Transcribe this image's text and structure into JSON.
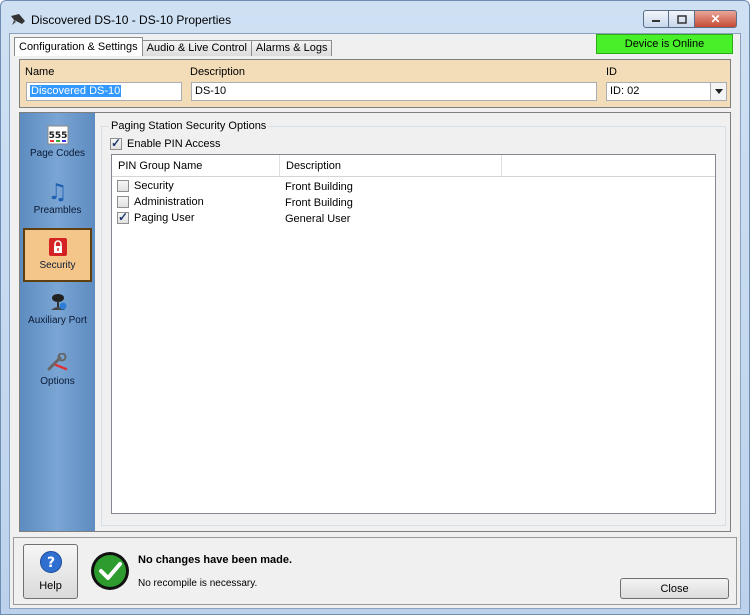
{
  "window": {
    "title": "Discovered DS-10 - DS-10 Properties",
    "controls": {
      "minimize": "—",
      "maximize": "□",
      "close": "✕"
    }
  },
  "tabs": [
    {
      "label": "Configuration & Settings",
      "active": true
    },
    {
      "label": "Audio & Live Control",
      "active": false
    },
    {
      "label": "Alarms & Logs",
      "active": false
    }
  ],
  "device_status": {
    "text": "Device is Online",
    "color": "#48f02a"
  },
  "header": {
    "name_label": "Name",
    "name_value": "Discovered DS-10",
    "description_label": "Description",
    "description_value": "DS-10",
    "id_label": "ID",
    "id_value": "ID: 02"
  },
  "sidebar": {
    "items": [
      {
        "label": "Page Codes",
        "icon": "page-codes-icon",
        "glyph": "555",
        "active": false
      },
      {
        "label": "Preambles",
        "icon": "music-note-icon",
        "glyph": "♫",
        "active": false
      },
      {
        "label": "Security",
        "icon": "lock-icon",
        "active": true
      },
      {
        "label": "Auxiliary Port",
        "icon": "microphone-icon",
        "active": false
      },
      {
        "label": "Options",
        "icon": "wrench-icon",
        "active": false
      }
    ]
  },
  "security": {
    "group_title": "Paging Station Security Options",
    "enable_pin_label": "Enable PIN Access",
    "enable_pin_checked": true,
    "columns": [
      "PIN Group Name",
      "Description"
    ],
    "rows": [
      {
        "name": "Security",
        "description": "Front Building",
        "checked": false
      },
      {
        "name": "Administration",
        "description": "Front Building",
        "checked": false
      },
      {
        "name": "Paging User",
        "description": "General User",
        "checked": true
      }
    ]
  },
  "footer": {
    "help_label": "Help",
    "message_title": "No changes have been made.",
    "message_sub": "No recompile is necessary.",
    "close_label": "Close"
  },
  "colors": {
    "header_panel": "#f3dcb8",
    "sidebar": "#6b98ca",
    "sidebar_active": "#f5c68a",
    "status_ok": "#1f7a1f"
  }
}
